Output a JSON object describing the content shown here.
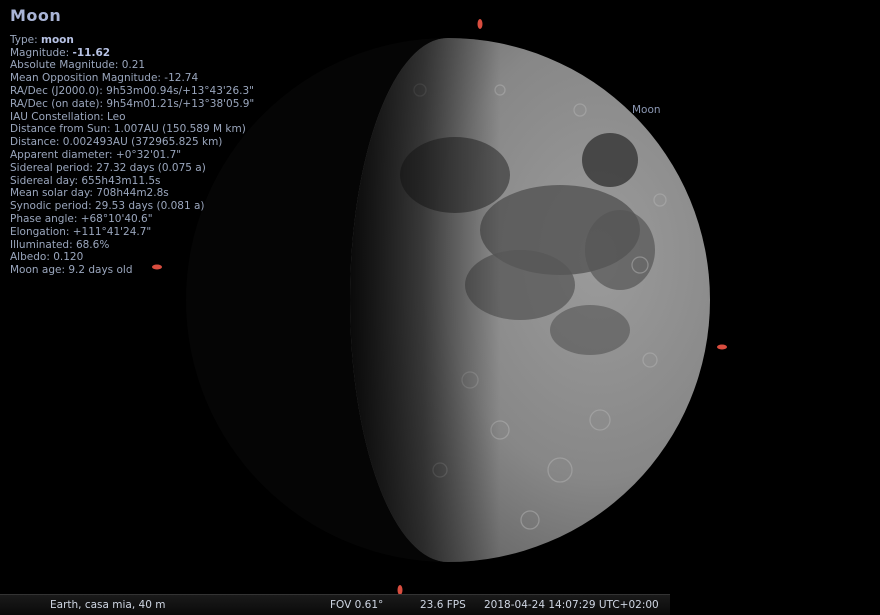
{
  "object": {
    "name": "Moon",
    "type_label": "Type:",
    "type_value": "moon",
    "magnitude_label": "Magnitude:",
    "magnitude_value": "-11.62",
    "lines": [
      "Absolute Magnitude: 0.21",
      "Mean Opposition Magnitude: -12.74",
      "RA/Dec (J2000.0): 9h53m00.94s/+13°43'26.3\"",
      "RA/Dec (on date): 9h54m01.21s/+13°38'05.9\"",
      "IAU Constellation: Leo",
      "Distance from Sun: 1.007AU (150.589 M km)",
      "Distance: 0.002493AU (372965.825 km)",
      "Apparent diameter: +0°32'01.7\"",
      "Sidereal period: 27.32 days (0.075 a)",
      "Sidereal day: 655h43m11.5s",
      "Mean solar day: 708h44m2.8s",
      "Synodic period: 29.53 days (0.081 a)",
      "Phase angle: +68°10'40.6\"",
      "Elongation: +111°41'24.7\"",
      "Illuminated: 68.6%",
      "Albedo: 0.120",
      "Moon age: 9.2 days old"
    ]
  },
  "sky_label": "Moon",
  "status": {
    "location": "Earth, casa mia, 40 m",
    "fov": "FOV 0.61°",
    "fps": "23.6 FPS",
    "datetime": "2018-04-24 14:07:29 UTC+02:00"
  },
  "colors": {
    "background": "#000000",
    "info_text": "#9aa6bd",
    "marker": "#ff5a4a"
  }
}
